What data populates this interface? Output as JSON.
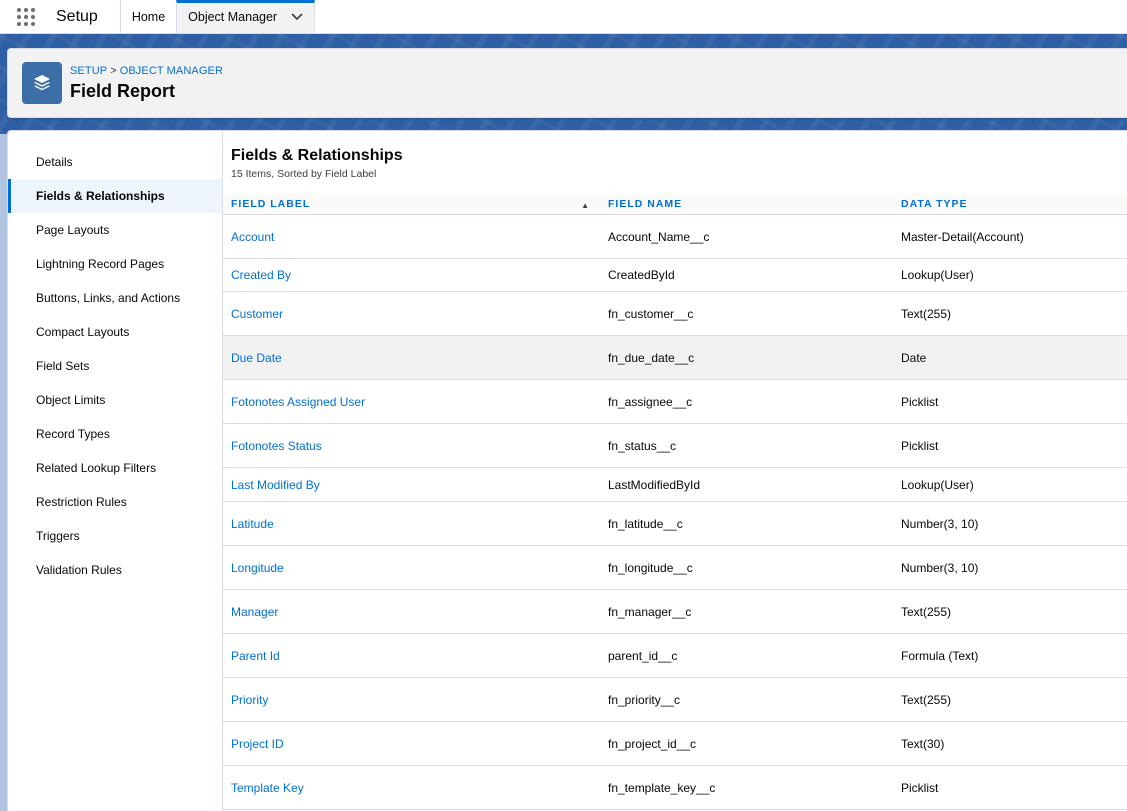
{
  "topbar": {
    "app_name": "Setup",
    "tabs": [
      {
        "label": "Home"
      },
      {
        "label": "Object Manager"
      }
    ]
  },
  "header": {
    "breadcrumb": [
      "SETUP",
      "OBJECT MANAGER"
    ],
    "breadcrumb_sep": ">",
    "title": "Field Report"
  },
  "sidebar": {
    "items": [
      {
        "label": "Details"
      },
      {
        "label": "Fields & Relationships"
      },
      {
        "label": "Page Layouts"
      },
      {
        "label": "Lightning Record Pages"
      },
      {
        "label": "Buttons, Links, and Actions"
      },
      {
        "label": "Compact Layouts"
      },
      {
        "label": "Field Sets"
      },
      {
        "label": "Object Limits"
      },
      {
        "label": "Record Types"
      },
      {
        "label": "Related Lookup Filters"
      },
      {
        "label": "Restriction Rules"
      },
      {
        "label": "Triggers"
      },
      {
        "label": "Validation Rules"
      }
    ]
  },
  "main": {
    "title": "Fields & Relationships",
    "subtitle": "15 Items, Sorted by Field Label",
    "columns": [
      "FIELD LABEL",
      "FIELD NAME",
      "DATA TYPE"
    ],
    "rows": [
      {
        "label": "Account",
        "name": "Account_Name__c",
        "type": "Master-Detail(Account)"
      },
      {
        "label": "Created By",
        "name": "CreatedById",
        "type": "Lookup(User)"
      },
      {
        "label": "Customer",
        "name": "fn_customer__c",
        "type": "Text(255)"
      },
      {
        "label": "Due Date",
        "name": "fn_due_date__c",
        "type": "Date"
      },
      {
        "label": "Fotonotes Assigned User",
        "name": "fn_assignee__c",
        "type": "Picklist"
      },
      {
        "label": "Fotonotes Status",
        "name": "fn_status__c",
        "type": "Picklist"
      },
      {
        "label": "Last Modified By",
        "name": "LastModifiedById",
        "type": "Lookup(User)"
      },
      {
        "label": "Latitude",
        "name": "fn_latitude__c",
        "type": "Number(3, 10)"
      },
      {
        "label": "Longitude",
        "name": "fn_longitude__c",
        "type": "Number(3, 10)"
      },
      {
        "label": "Manager",
        "name": "fn_manager__c",
        "type": "Text(255)"
      },
      {
        "label": "Parent Id",
        "name": "parent_id__c",
        "type": "Formula (Text)"
      },
      {
        "label": "Priority",
        "name": "fn_priority__c",
        "type": "Text(255)"
      },
      {
        "label": "Project ID",
        "name": "fn_project_id__c",
        "type": "Text(30)"
      },
      {
        "label": "Template Key",
        "name": "fn_template_key__c",
        "type": "Picklist"
      }
    ]
  },
  "icons": {
    "app_launcher": "waffle-icon",
    "tab_menu": "chevron-down-icon",
    "object": "stacked-layers-icon",
    "sort": "sort-ascending-icon"
  },
  "colors": {
    "brand_blue": "#0070d2",
    "header_band": "#2e5fa4",
    "object_icon_bg": "#3c6fa8"
  }
}
